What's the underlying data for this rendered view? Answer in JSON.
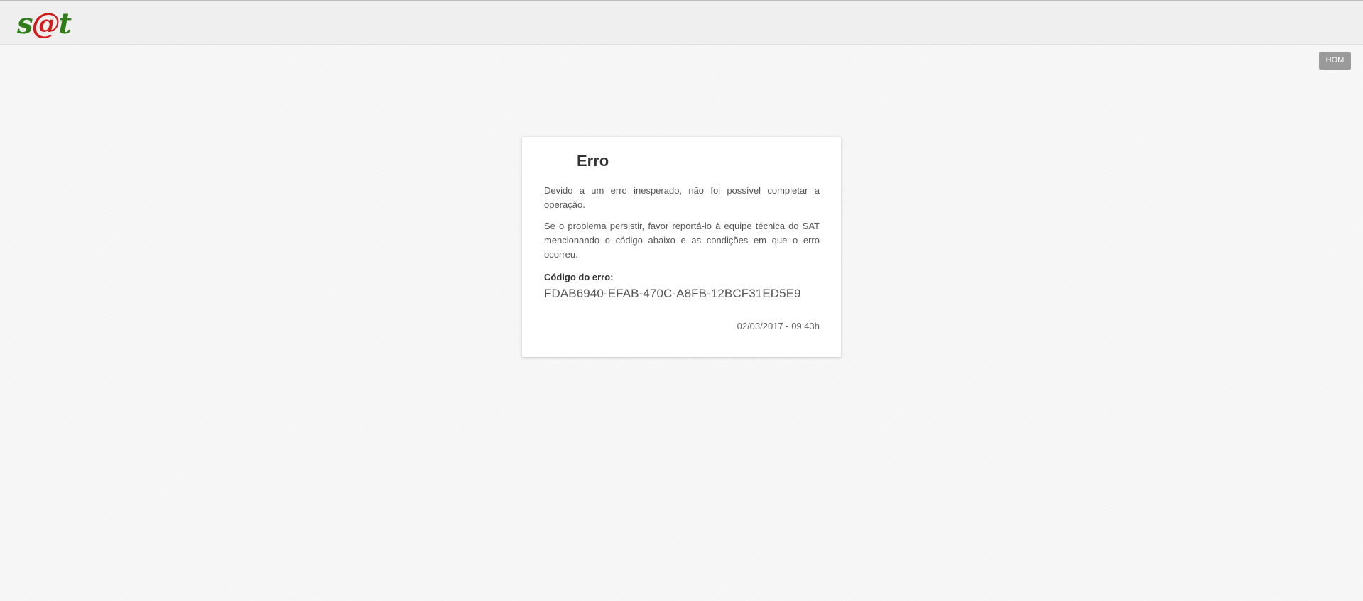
{
  "header": {
    "logo": {
      "part1": "s",
      "part2": "@",
      "part3": "t",
      "colors": {
        "primary": "#2f7d17",
        "accent": "#d01c1c"
      }
    },
    "environment_badge": "HOM"
  },
  "error_card": {
    "title": "Erro",
    "message_1": "Devido a um erro inesperado, não foi possível completar a operação.",
    "message_2": "Se o problema persistir, favor reportá-lo à equipe técnica do SAT mencionando o código abaixo e as condições em que o erro ocorreu.",
    "code_label": "Código do erro:",
    "code_value": "FDAB6940-EFAB-470C-A8FB-12BCF31ED5E9",
    "timestamp": "02/03/2017 - 09:43h"
  }
}
